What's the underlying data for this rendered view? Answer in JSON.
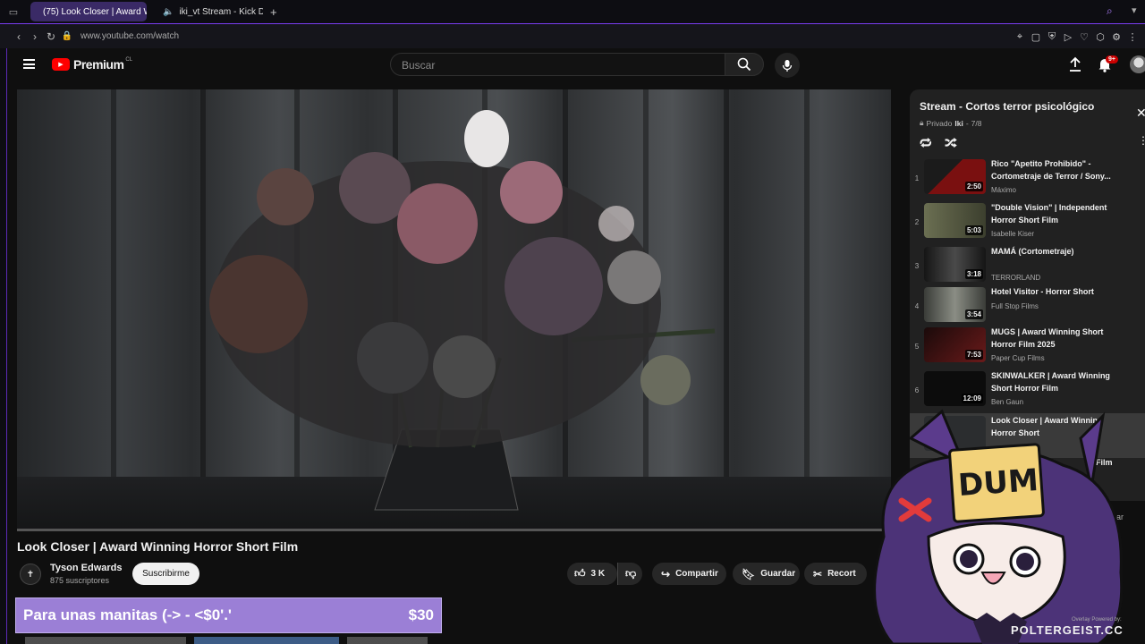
{
  "browser": {
    "tabs": [
      {
        "label": "(75) Look Closer | Award W",
        "active": true,
        "icon": "youtube-icon"
      },
      {
        "label": "iki_vt Stream - Kick De",
        "active": false,
        "icon": "kick-icon"
      }
    ],
    "new_tab": "+",
    "url": "www.youtube.com/watch"
  },
  "header": {
    "brand": "Premium",
    "brand_region": "CL",
    "search_placeholder": "Buscar",
    "notifications_badge": "9+"
  },
  "video": {
    "title": "Look Closer | Award Winning Horror Short Film",
    "progress": 0.0,
    "channel": {
      "name": "Tyson Edwards",
      "subscribers": "875 suscriptores"
    },
    "subscribe_label": "Suscribirme",
    "actions": {
      "likes": "3 K",
      "share": "Compartir",
      "save": "Guardar",
      "clip": "Recort"
    }
  },
  "donation": {
    "message": "Para unas manitas (-> - <$0'.'",
    "amount": "$30"
  },
  "playlist": {
    "title": "Stream - Cortos terror psicológico",
    "privacy": "Privado",
    "owner": "Iki",
    "position": "7/8",
    "items": [
      {
        "num": "1",
        "title": "Rico \"Apetito Prohibido\" - Cortometraje de Terror / Sony...",
        "channel": "Máximo",
        "duration": "2:50",
        "thumb": "#5a1010"
      },
      {
        "num": "2",
        "title": "\"Double Vision\" | Independent Horror Short Film",
        "channel": "Isabelle Kiser",
        "duration": "5:03",
        "thumb": "#555a40"
      },
      {
        "num": "3",
        "title": "MAMÁ (Cortometraje)",
        "channel": "TERRORLAND",
        "duration": "3:18",
        "thumb": "#2a2a2a"
      },
      {
        "num": "4",
        "title": "Hotel Visitor - Horror Short",
        "channel": "Full Stop Films",
        "duration": "3:54",
        "thumb": "#6b6e66"
      },
      {
        "num": "5",
        "title": "MUGS | Award Winning Short Horror Film 2025",
        "channel": "Paper Cup Films",
        "duration": "7:53",
        "thumb": "#3a1515"
      },
      {
        "num": "6",
        "title": "SKINWALKER | Award Winning Short Horror Film",
        "channel": "Ben Gaun",
        "duration": "12:09",
        "thumb": "#111111"
      },
      {
        "num": "",
        "title": "Look Closer | Award Winning Horror Short",
        "channel": "",
        "duration": "",
        "thumb": "#2b2d2f"
      }
    ],
    "partial_text": "Film",
    "partial_text_2": "Par"
  },
  "overlay": {
    "sign": "DUM",
    "watermark": "POLTERGEIST.CC",
    "powered": "Overlay Powered by:"
  }
}
